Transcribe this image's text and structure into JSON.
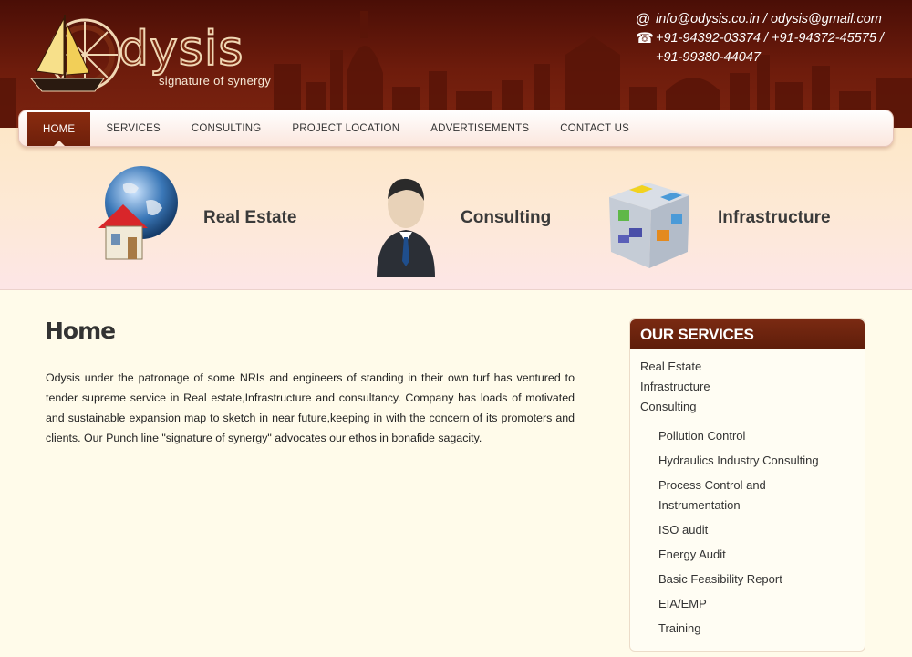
{
  "header": {
    "logo_word": "dysis",
    "tagline": "signature of synergy",
    "email_line": "info@odysis.co.in / odysis@gmail.com",
    "phone_line1": "+91-94392-03374 / +91-94372-45575 /",
    "phone_line2": "+91-99380-44047",
    "email_icon": "@",
    "phone_icon": "☎"
  },
  "nav": {
    "items": [
      "HOME",
      "SERVICES",
      "CONSULTING",
      "PROJECT LOCATION",
      "ADVERTISEMENTS",
      "CONTACT US"
    ],
    "active": "HOME"
  },
  "features": [
    {
      "label": "Real Estate",
      "icon": "globe-house-icon"
    },
    {
      "label": "Consulting",
      "icon": "businessman-icon"
    },
    {
      "label": "Infrastructure",
      "icon": "cube-icon"
    }
  ],
  "main": {
    "title": "Home",
    "body": "Odysis under the patronage of some NRIs and engineers of standing in their own turf has ventured to tender supreme service in Real estate,Infrastructure and consultancy. Company has loads of motivated and sustainable expansion map to sketch in near future,keeping in with the concern of its promoters and clients. Our Punch line \"signature of synergy\" advocates our ethos in bonafide sagacity."
  },
  "sidebar": {
    "title": "OUR SERVICES",
    "top_items": [
      "Real Estate",
      "Infrastructure",
      "Consulting"
    ],
    "sub_items": [
      "Pollution Control",
      "Hydraulics Industry Consulting",
      "Process Control and Instrumentation",
      "ISO audit",
      "Energy Audit",
      "Basic Feasibility Report",
      "EIA/EMP",
      "Training"
    ]
  },
  "colors": {
    "header_dark": "#4a0e06",
    "accent_brown": "#7a2a12",
    "page_bg": "#fffbea"
  }
}
